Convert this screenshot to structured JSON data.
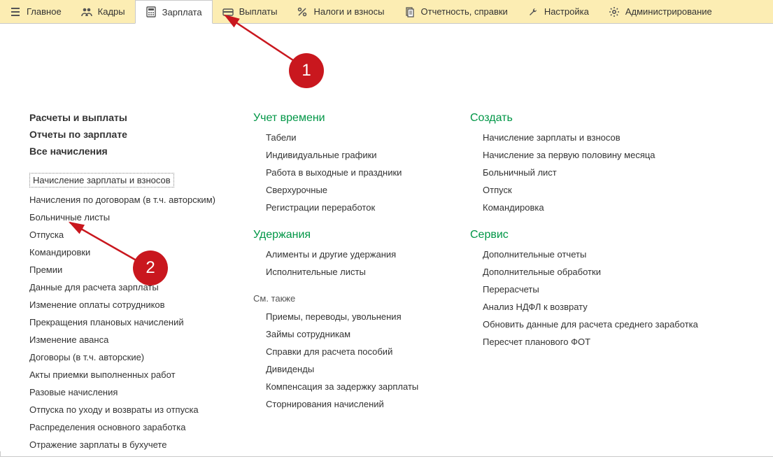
{
  "topbar": {
    "items": [
      {
        "label": "Главное",
        "icon": "menu"
      },
      {
        "label": "Кадры",
        "icon": "people"
      },
      {
        "label": "Зарплата",
        "icon": "calc",
        "active": true
      },
      {
        "label": "Выплаты",
        "icon": "wallet"
      },
      {
        "label": "Налоги и взносы",
        "icon": "percent"
      },
      {
        "label": "Отчетность, справки",
        "icon": "docs"
      },
      {
        "label": "Настройка",
        "icon": "wrench"
      },
      {
        "label": "Администрирование",
        "icon": "gear"
      }
    ]
  },
  "col1": {
    "bold_links": [
      "Расчеты и выплаты",
      "Отчеты по зарплате",
      "Все начисления"
    ],
    "links": [
      "Начисление зарплаты и взносов",
      "Начисления по договорам (в т.ч. авторским)",
      "Больничные листы",
      "Отпуска",
      "Командировки",
      "Премии",
      "Данные для расчета зарплаты",
      "Изменение оплаты сотрудников",
      "Прекращения плановых начислений",
      "Изменение аванса",
      "Договоры (в т.ч. авторские)",
      "Акты приемки выполненных работ",
      "Разовые начисления",
      "Отпуска по уходу и возвраты из отпуска",
      "Распределения основного заработка",
      "Отражение зарплаты в бухучете"
    ]
  },
  "col2": {
    "groups": [
      {
        "title": "Учет времени",
        "links": [
          "Табели",
          "Индивидуальные графики",
          "Работа в выходные и праздники",
          "Сверхурочные",
          "Регистрации переработок"
        ]
      },
      {
        "title": "Удержания",
        "links": [
          "Алименты и другие удержания",
          "Исполнительные листы"
        ]
      }
    ],
    "see_also_label": "См. также",
    "see_also": [
      "Приемы, переводы, увольнения",
      "Займы сотрудникам",
      "Справки для расчета пособий",
      "Дивиденды",
      "Компенсация за задержку зарплаты",
      "Сторнирования начислений"
    ]
  },
  "col3": {
    "groups": [
      {
        "title": "Создать",
        "links": [
          "Начисление зарплаты и взносов",
          "Начисление за первую половину месяца",
          "Больничный лист",
          "Отпуск",
          "Командировка"
        ]
      },
      {
        "title": "Сервис",
        "links": [
          "Дополнительные отчеты",
          "Дополнительные обработки",
          "Перерасчеты",
          "Анализ НДФЛ к возврату",
          "Обновить данные для расчета среднего заработка",
          "Пересчет планового ФОТ"
        ]
      }
    ]
  },
  "annotations": {
    "b1": "1",
    "b2": "2"
  }
}
